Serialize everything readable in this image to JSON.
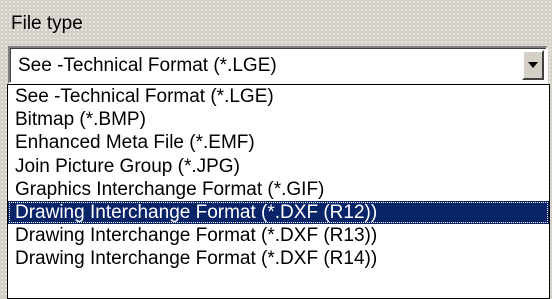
{
  "file_type": {
    "label": "File type",
    "selected_value": "See -Technical Format (*.LGE)",
    "dropdown_icon": "chevron-down-icon",
    "options": [
      "See -Technical Format (*.LGE)",
      "Bitmap (*.BMP)",
      "Enhanced Meta File (*.EMF)",
      "Join Picture Group (*.JPG)",
      "Graphics Interchange Format (*.GIF)",
      "Drawing Interchange Format (*.DXF (R12))",
      "Drawing Interchange Format (*.DXF (R13))",
      "Drawing Interchange Format (*.DXF (R14))"
    ],
    "highlighted_index": 5
  },
  "colors": {
    "dialog_background": "#d4d0c8",
    "selection_background": "#0a246a",
    "selection_text": "#ffffff"
  }
}
